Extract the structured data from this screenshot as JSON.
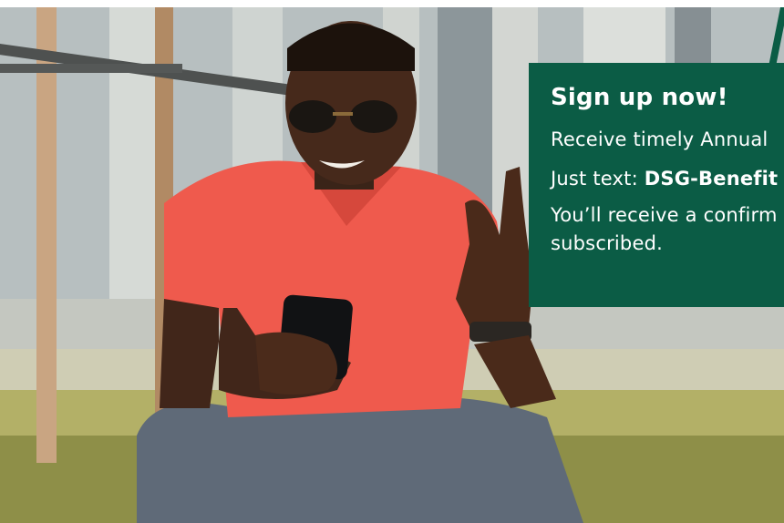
{
  "promo": {
    "title": "Sign up now!",
    "line1": "Receive timely Annual",
    "line2_prefix": "Just text: ",
    "line2_keyword": "DSG-Benefit",
    "line3a": "You’ll receive a confirm",
    "line3b": "subscribed."
  },
  "colors": {
    "card_background": "#0b5c45",
    "card_text": "#ffffff",
    "shirt": "#ef5a4d"
  }
}
